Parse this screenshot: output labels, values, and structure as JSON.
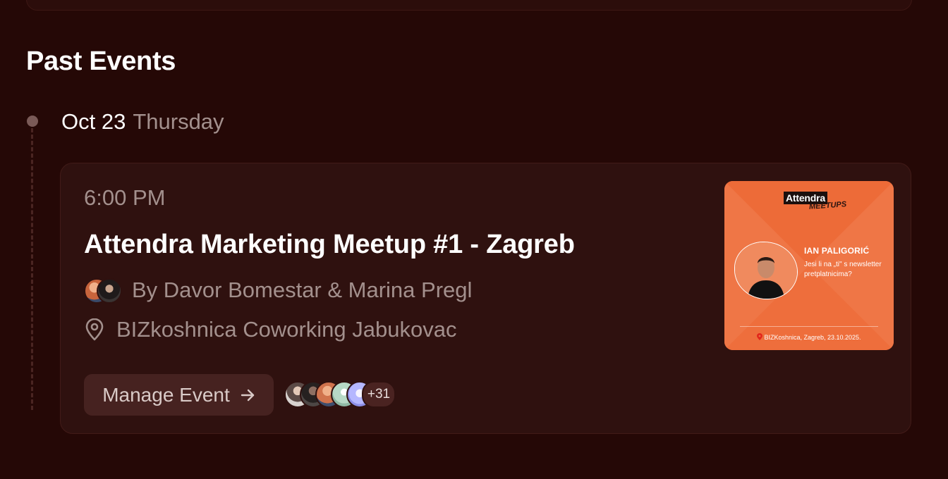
{
  "section": {
    "title": "Past Events"
  },
  "date": {
    "main": "Oct 23",
    "weekday": "Thursday"
  },
  "event": {
    "time": "6:00 PM",
    "title": "Attendra Marketing Meetup #1 - Zagreb",
    "hosts": "By Davor Bomestar & Marina Pregl",
    "location": "BIZkoshnica Coworking Jabukovac",
    "manage_label": "Manage Event",
    "guest_extra": "+31"
  },
  "poster": {
    "brand": "Attendra",
    "brand_sub": "MEETUPS",
    "speaker": "IAN PALIGORIĆ",
    "question": "Jesi li na „ti\" s newsletter pretplatnicima?",
    "footer": "BIZKoshnica, Zagreb, 23.10.2025."
  },
  "colors": {
    "background": "#250806",
    "card": "#2f110f",
    "muted_text": "#a3908d",
    "poster_orange": "#ee6e3c"
  },
  "icons": [
    "location-pin-icon",
    "arrow-right-icon",
    "timeline-dot"
  ]
}
